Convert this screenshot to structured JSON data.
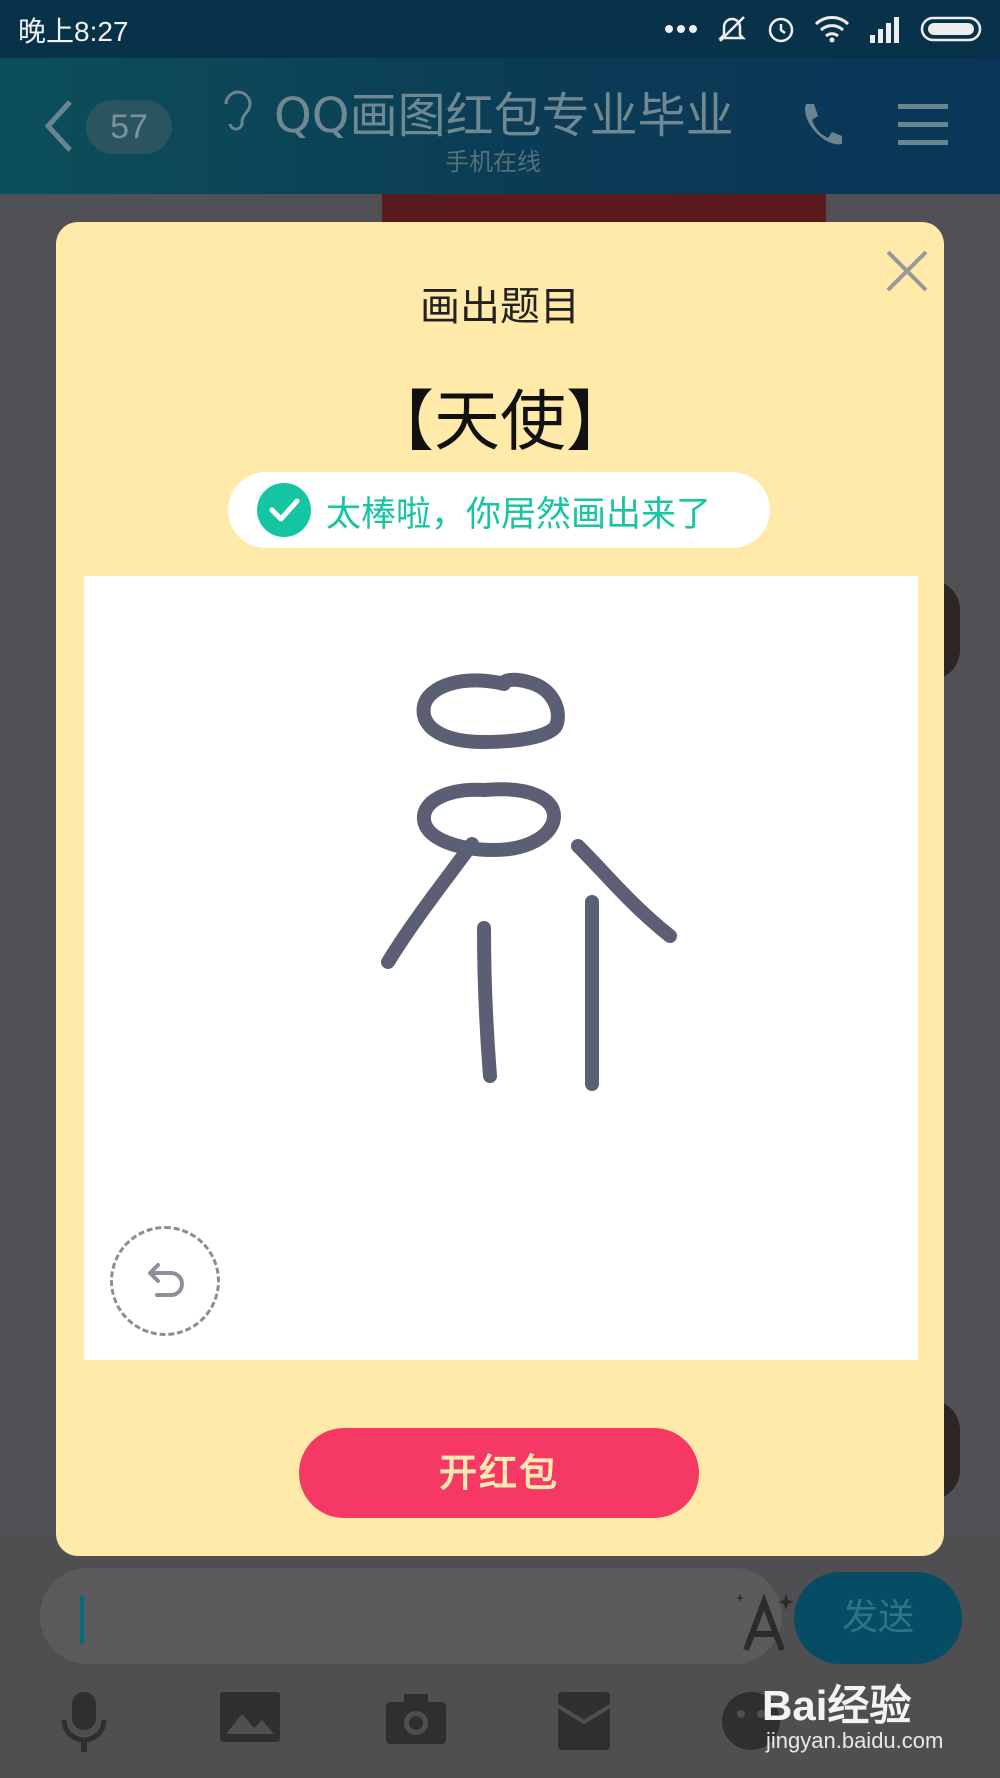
{
  "status_bar": {
    "time": "晚上8:27"
  },
  "chat_header": {
    "unread_count": "57",
    "title": "QQ画图红包专业毕业",
    "subtitle": "手机在线"
  },
  "input_bar": {
    "send_label": "发送"
  },
  "drawing_modal": {
    "heading": "画出题目",
    "topic": "【天使】",
    "result_message": "太棒啦，你居然画出来了",
    "open_button_label": "开红包"
  },
  "watermark": {
    "logo": "Bai经验",
    "url": "jingyan.baidu.com"
  },
  "colors": {
    "modal_bg": "#ffeaaa",
    "accent_red": "#f63864",
    "success_green": "#16c5a2",
    "stroke": "#5a5f73"
  }
}
